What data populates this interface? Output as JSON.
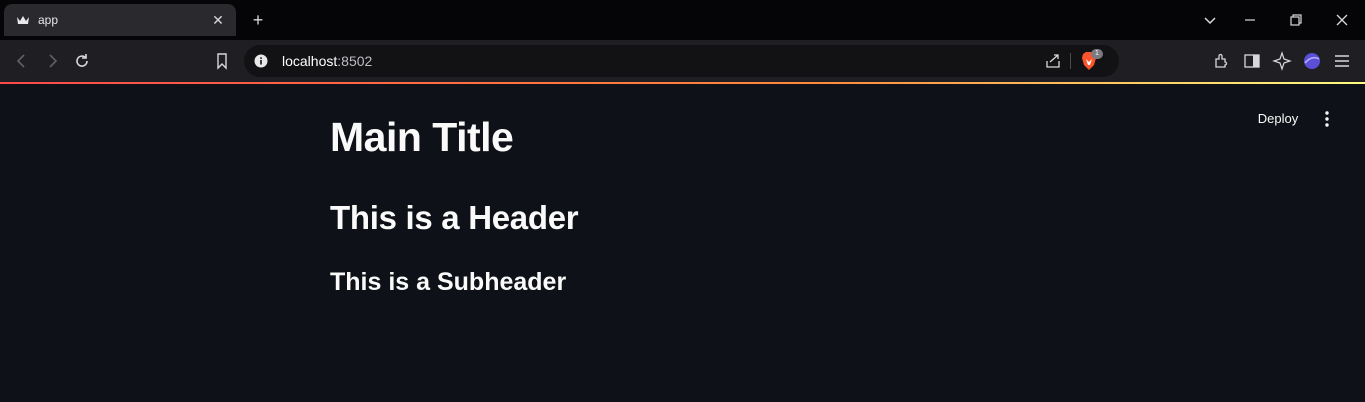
{
  "browser": {
    "tab": {
      "title": "app",
      "close_glyph": "✕"
    },
    "new_tab_glyph": "+",
    "address": {
      "host": "localhost",
      "port": ":8502"
    },
    "brave_badge_count": "1",
    "colors": {
      "tabstrip": "#050507",
      "toolbar": "#1f1f23",
      "omnibox": "#121215",
      "brave": "#fb542b"
    }
  },
  "app": {
    "deploy_label": "Deploy",
    "title": "Main Title",
    "header": "This is a Header",
    "subheader": "This is a Subheader",
    "colors": {
      "background": "#0e1117",
      "text": "#fafafa",
      "accent_gradient": [
        "#ff4b4b",
        "#fffd80"
      ]
    }
  }
}
